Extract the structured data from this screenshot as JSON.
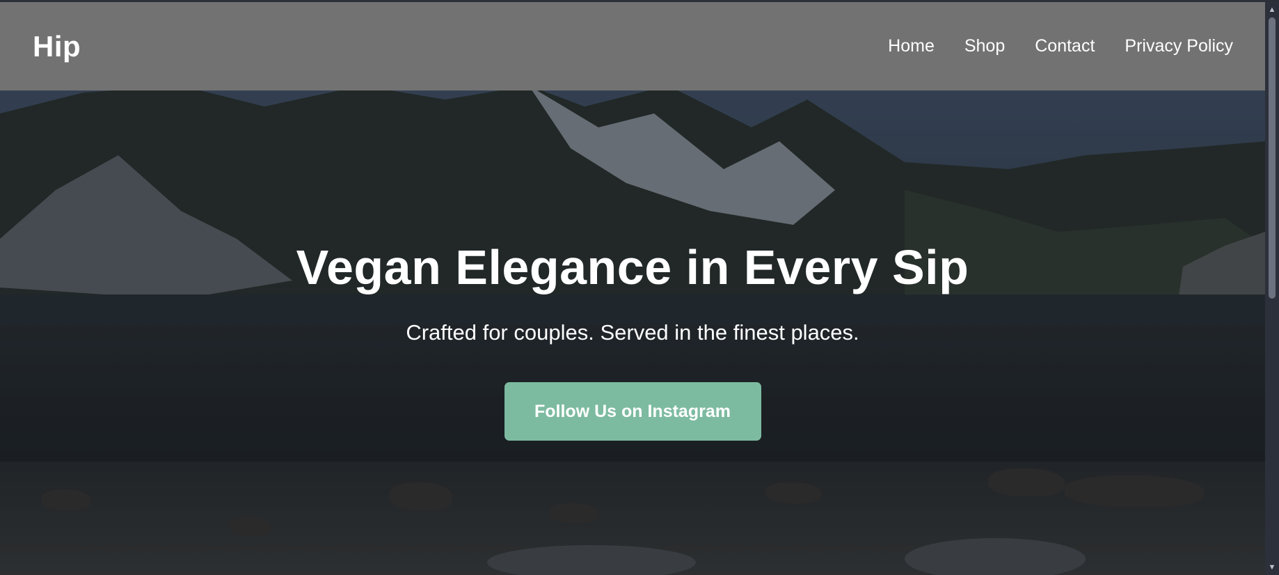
{
  "site": {
    "logo": "Hip"
  },
  "nav": {
    "items": [
      {
        "label": "Home"
      },
      {
        "label": "Shop"
      },
      {
        "label": "Contact"
      },
      {
        "label": "Privacy Policy"
      }
    ]
  },
  "hero": {
    "title": "Vegan Elegance in Every Sip",
    "subtitle": "Crafted for couples. Served in the finest places.",
    "cta_label": "Follow Us on Instagram"
  },
  "colors": {
    "header_bg": "#727272",
    "cta_bg": "#7dbba1",
    "text": "#ffffff"
  },
  "icons": {
    "scroll_up": "chevron-up-icon",
    "scroll_down": "chevron-down-icon"
  }
}
